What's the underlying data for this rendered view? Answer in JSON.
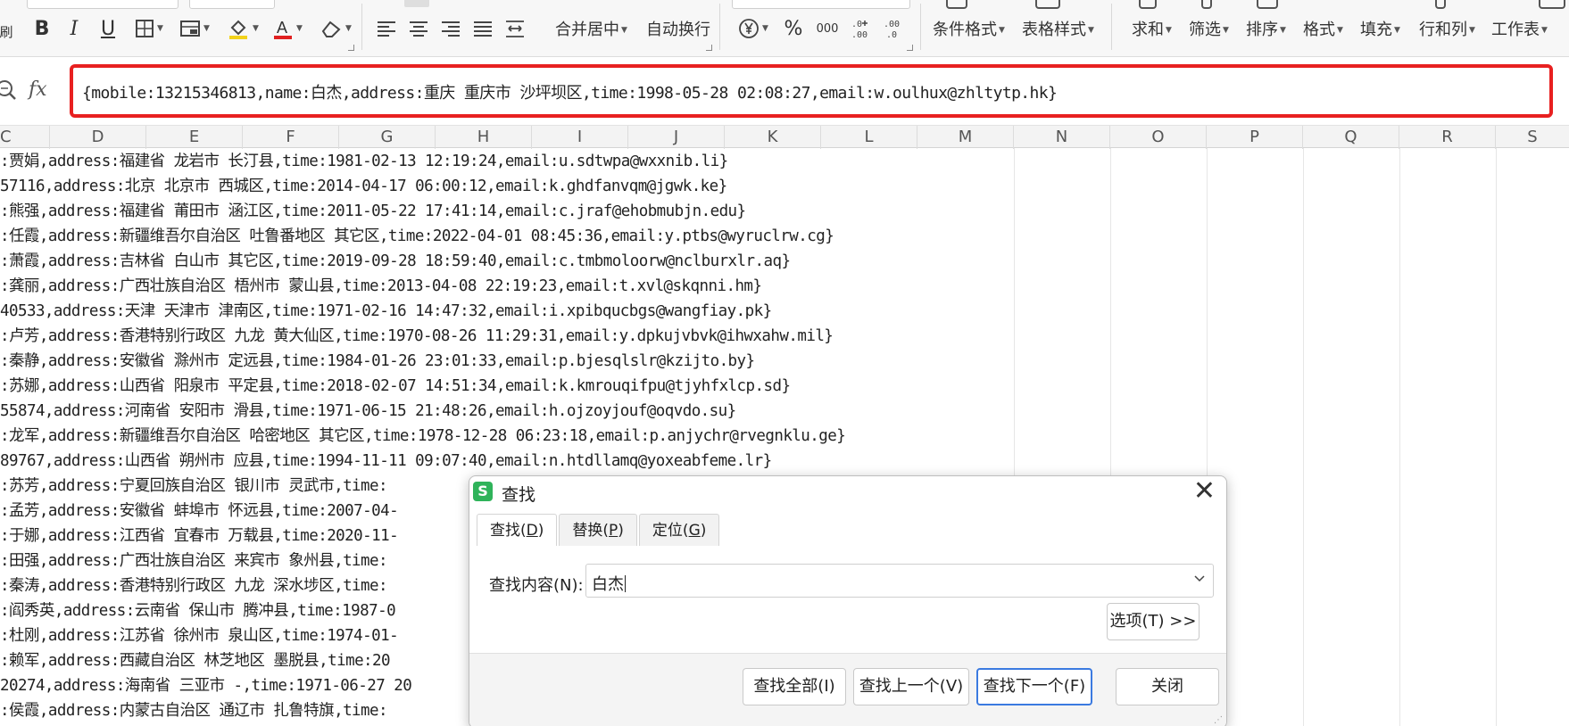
{
  "ribbon": {
    "left_label": "刷",
    "bold": "B",
    "italic": "I",
    "underline": "U",
    "merge_center": "合并居中",
    "wrap_text": "自动换行",
    "percent": "%",
    "thousands": "000",
    "inc_decimal": "+0\n.00",
    "dec_decimal": ".00\n→.0",
    "conditional_format": "条件格式",
    "table_style": "表格样式",
    "sum": "求和",
    "filter": "筛选",
    "sort": "排序",
    "format": "格式",
    "fill": "填充",
    "rows_cols": "行和列",
    "worksheet": "工作表",
    "font_color_accent": "#e02020",
    "fill_color_accent": "#f2d21b"
  },
  "formula_bar": {
    "fx": "fx",
    "content": "{mobile:13215346813,name:白杰,address:重庆 重庆市 沙坪坝区,time:1998-05-28 02:08:27,email:w.oulhux@zhltytp.hk}",
    "highlight_color": "#e82020"
  },
  "columns": [
    "C",
    "D",
    "E",
    "F",
    "G",
    "H",
    "I",
    "J",
    "K",
    "L",
    "M",
    "N",
    "O",
    "P",
    "Q",
    "R",
    "S"
  ],
  "rows": [
    ":贾娟,address:福建省 龙岩市 长汀县,time:1981-02-13 12:19:24,email:u.sdtwpa@wxxnib.li}",
    "57116,address:北京 北京市 西城区,time:2014-04-17 06:00:12,email:k.ghdfanvqm@jgwk.ke}",
    ":熊强,address:福建省 莆田市 涵江区,time:2011-05-22 17:41:14,email:c.jraf@ehobmubjn.edu}",
    ":任霞,address:新疆维吾尔自治区 吐鲁番地区 其它区,time:2022-04-01 08:45:36,email:y.ptbs@wyruclrw.cg}",
    ":萧霞,address:吉林省 白山市 其它区,time:2019-09-28 18:59:40,email:c.tmbmoloorw@nclburxlr.aq}",
    ":龚丽,address:广西壮族自治区 梧州市 蒙山县,time:2013-04-08 22:19:23,email:t.xvl@skqnni.hm}",
    "40533,address:天津 天津市 津南区,time:1971-02-16 14:47:32,email:i.xpibqucbgs@wangfiay.pk}",
    ":卢芳,address:香港特别行政区 九龙 黄大仙区,time:1970-08-26 11:29:31,email:y.dpkujvbvk@ihwxahw.mil}",
    ":秦静,address:安徽省 滁州市 定远县,time:1984-01-26 23:01:33,email:p.bjesqlslr@kzijto.by}",
    ":苏娜,address:山西省 阳泉市 平定县,time:2018-02-07 14:51:34,email:k.kmrouqifpu@tjyhfxlcp.sd}",
    "55874,address:河南省 安阳市 滑县,time:1971-06-15 21:48:26,email:h.ojzoyjouf@oqvdo.su}",
    ":龙军,address:新疆维吾尔自治区 哈密地区 其它区,time:1978-12-28 06:23:18,email:p.anjychr@rvegnklu.ge}",
    "89767,address:山西省 朔州市 应县,time:1994-11-11 09:07:40,email:n.htdllamq@yoxeabfeme.lr}",
    ":苏芳,address:宁夏回族自治区 银川市 灵武市,time:",
    ":孟芳,address:安徽省 蚌埠市 怀远县,time:2007-04-",
    ":于娜,address:江西省 宜春市 万载县,time:2020-11-",
    ":田强,address:广西壮族自治区 来宾市 象州县,time:",
    ":秦涛,address:香港特别行政区 九龙 深水埗区,time:",
    ":阎秀英,address:云南省 保山市 腾冲县,time:1987-0",
    ":杜刚,address:江苏省 徐州市 泉山区,time:1974-01-",
    ":赖军,address:西藏自治区 林芝地区 墨脱县,time:20",
    "20274,address:海南省 三亚市 -,time:1971-06-27 20",
    ":侯霞,address:内蒙古自治区 通辽市 扎鲁特旗,time:"
  ],
  "dialog": {
    "title": "查找",
    "logo": "S",
    "close": "✕",
    "tabs": [
      {
        "label": "查找(",
        "key": "D",
        "end": ")"
      },
      {
        "label": "替换(",
        "key": "P",
        "end": ")"
      },
      {
        "label": "定位(",
        "key": "G",
        "end": ")"
      }
    ],
    "find_label": "查找内容(N):",
    "find_value": "白杰",
    "options_button": "选项(T) >>",
    "find_all": "查找全部(I)",
    "find_prev": "查找上一个(V)",
    "find_next": "查找下一个(F)",
    "close_button": "关闭"
  }
}
